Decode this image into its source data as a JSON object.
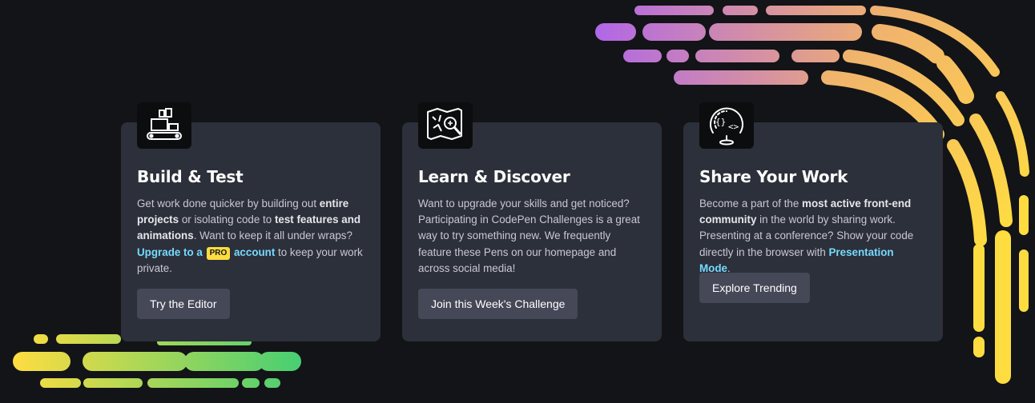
{
  "cards": [
    {
      "title": "Build & Test",
      "text": {
        "a": "Get work done quicker by building out ",
        "b": "entire projects",
        "c": " or isolating code to ",
        "d": "test features and animations",
        "e": ". Want to keep it all under wraps? ",
        "link_a": "Upgrade to a",
        "badge": "PRO",
        "link_b": "account",
        "f": " to keep your work private."
      },
      "button": "Try the Editor",
      "icon": "build-test-icon"
    },
    {
      "title": "Learn & Discover",
      "text": {
        "a": "Want to upgrade your skills and get noticed? Participating in CodePen Challenges is a great way to try something new. We frequently feature these Pens on our homepage and across social media!"
      },
      "button": "Join this Week's Challenge",
      "icon": "map-search-icon"
    },
    {
      "title": "Share Your Work",
      "text": {
        "a": "Become a part of the ",
        "b": "most active front-end community",
        "c": " in the world by sharing work. Presenting at a conference? Show your code directly in the browser with ",
        "link": "Presentation Mode",
        "d": "."
      },
      "button": "Explore Trending",
      "icon": "code-globe-icon"
    }
  ],
  "colors": {
    "background": "#131417",
    "card": "#2c303a",
    "button": "#444857",
    "link": "#76daff",
    "badge": "#ffdd40",
    "gradient_purple": "#b066e8",
    "gradient_peach": "#f0b070",
    "gradient_yellow": "#ffdd40",
    "gradient_green": "#47cf73"
  }
}
